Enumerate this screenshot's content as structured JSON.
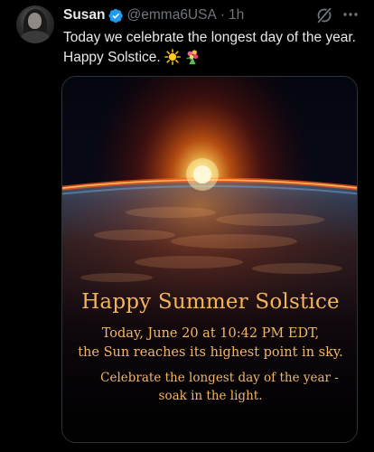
{
  "tweet": {
    "author_name": "Susan",
    "author_handle": "@emma6USA",
    "separator": "·",
    "timestamp": "1h",
    "text": "Today we celebrate the longest day of the year.  Happy Solstice.",
    "emojis": [
      "sun-emoji",
      "bouquet-emoji"
    ]
  },
  "media": {
    "title": "Happy Summer Solstice",
    "line1": "Today, June 20 at 10:42 PM EDT,",
    "line2": "the Sun reaches its highest point in sky.",
    "line3": "Celebrate the longest day of the year -",
    "line4": "soak in the light."
  },
  "icons": {
    "verified": "verified-badge-icon",
    "grok": "grok-icon",
    "more": "more-icon"
  },
  "colors": {
    "background": "#000000",
    "text": "#e7e9ea",
    "secondary": "#71767b",
    "verified": "#1d9bf0",
    "caption": "#f4b45c"
  }
}
